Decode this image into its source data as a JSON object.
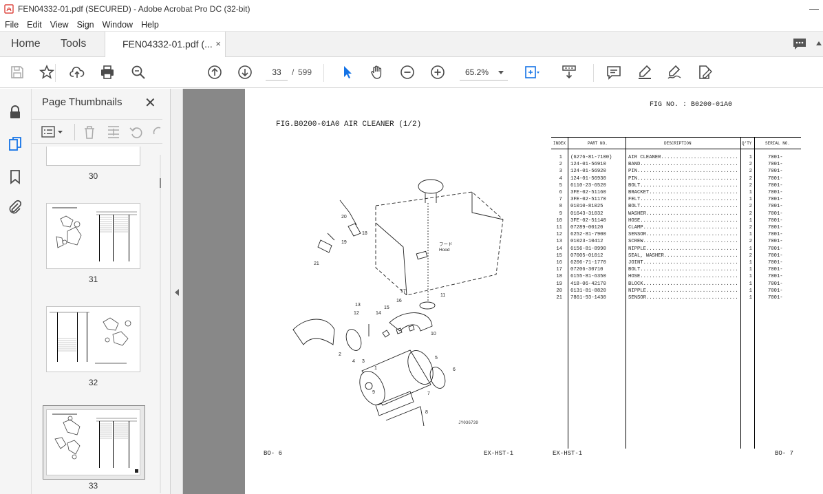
{
  "window": {
    "title": "FEN04332-01.pdf (SECURED) - Adobe Acrobat Pro DC (32-bit)",
    "minimize_glyph": "—"
  },
  "menu": [
    "File",
    "Edit",
    "View",
    "Sign",
    "Window",
    "Help"
  ],
  "tabs": {
    "home": "Home",
    "tools": "Tools",
    "document": "FEN04332-01.pdf (...",
    "close_glyph": "×"
  },
  "toolbar": {
    "current_page": "33",
    "page_separator": "/",
    "total_pages": "599",
    "zoom": "65.2%"
  },
  "thumbnails": {
    "title": "Page Thumbnails",
    "close_glyph": "✕",
    "pages": [
      {
        "label": "30"
      },
      {
        "label": "31"
      },
      {
        "label": "32"
      },
      {
        "label": "33",
        "selected": true
      }
    ]
  },
  "document": {
    "fig_no": "FIG NO. : B0200-01A0",
    "fig_title": "FIG.B0200-01A0   AIR CLEANER   (1/2)",
    "drawing_code": "JY036739",
    "diagram_callouts": [
      "20",
      "18",
      "19",
      "21",
      "17",
      "16",
      "15",
      "14",
      "13",
      "12",
      "11",
      "10",
      "2",
      "4",
      "3",
      "1",
      "5",
      "6",
      "7",
      "8",
      "9"
    ],
    "diagram_text": {
      "jp": "フード",
      "en": "Hood"
    },
    "footer": {
      "left_page": "BO-  6",
      "left_model": "EX-HST-1",
      "right_model": "EX-HST-1",
      "right_page": "BO-  7"
    },
    "table_headers": {
      "index": "INDEX",
      "part_no": "PART NO.",
      "description": "DESCRIPTION",
      "qty": "Q'TY",
      "serial": "SERIAL NO."
    },
    "parts": [
      {
        "index": "1",
        "part_no": "(6276-81-7100)",
        "description": "AIR CLEANER..........................",
        "qty": "1",
        "serial": "7001-"
      },
      {
        "index": "2",
        "part_no": "124-01-56910",
        "description": "BAND.................................",
        "qty": "2",
        "serial": "7001-"
      },
      {
        "index": "3",
        "part_no": "124-01-56920",
        "description": "PIN..................................",
        "qty": "2",
        "serial": "7001-"
      },
      {
        "index": "4",
        "part_no": "124-01-56930",
        "description": "PIN..................................",
        "qty": "2",
        "serial": "7001-"
      },
      {
        "index": "5",
        "part_no": "6110-23-6520",
        "description": "BOLT.................................",
        "qty": "2",
        "serial": "7001-"
      },
      {
        "index": "6",
        "part_no": "3FE-02-51160",
        "description": "BRACKET..............................",
        "qty": "1",
        "serial": "7001-"
      },
      {
        "index": "7",
        "part_no": "3FE-02-51170",
        "description": "FELT.................................",
        "qty": "1",
        "serial": "7001-"
      },
      {
        "index": "8",
        "part_no": "01010-81025",
        "description": "BOLT.................................",
        "qty": "2",
        "serial": "7001-"
      },
      {
        "index": "9",
        "part_no": "01643-31032",
        "description": "WASHER...............................",
        "qty": "2",
        "serial": "7001-"
      },
      {
        "index": "10",
        "part_no": "3FE-02-51140",
        "description": "HOSE.................................",
        "qty": "1",
        "serial": "7001-"
      },
      {
        "index": "11",
        "part_no": "07289-00120",
        "description": "CLAMP................................",
        "qty": "2",
        "serial": "7001-"
      },
      {
        "index": "12",
        "part_no": "6252-81-7900",
        "description": "SENSOR...............................",
        "qty": "1",
        "serial": "7001-"
      },
      {
        "index": "13",
        "part_no": "01023-10412",
        "description": "SCREW................................",
        "qty": "2",
        "serial": "7001-"
      },
      {
        "index": "14",
        "part_no": "6156-81-8990",
        "description": "NIPPLE...............................",
        "qty": "1",
        "serial": "7001-"
      },
      {
        "index": "15",
        "part_no": "07005-01012",
        "description": "SEAL, WASHER.........................",
        "qty": "2",
        "serial": "7001-"
      },
      {
        "index": "16",
        "part_no": "6206-71-1770",
        "description": "JOINT................................",
        "qty": "1",
        "serial": "7001-"
      },
      {
        "index": "17",
        "part_no": "07206-30710",
        "description": "BOLT.................................",
        "qty": "1",
        "serial": "7001-"
      },
      {
        "index": "18",
        "part_no": "6155-81-6350",
        "description": "HOSE.................................",
        "qty": "1",
        "serial": "7001-"
      },
      {
        "index": "19",
        "part_no": "418-06-42170",
        "description": "BLOCK................................",
        "qty": "1",
        "serial": "7001-"
      },
      {
        "index": "20",
        "part_no": "6131-81-8820",
        "description": "NIPPLE...............................",
        "qty": "1",
        "serial": "7001-"
      },
      {
        "index": "21",
        "part_no": "7861-93-1430",
        "description": "SENSOR...............................",
        "qty": "1",
        "serial": "7001-"
      }
    ]
  },
  "colors": {
    "accent_blue": "#1473e6",
    "icon_gray": "#4b4b4b",
    "doc_background": "#888888",
    "pdf_red": "#d7261d"
  }
}
